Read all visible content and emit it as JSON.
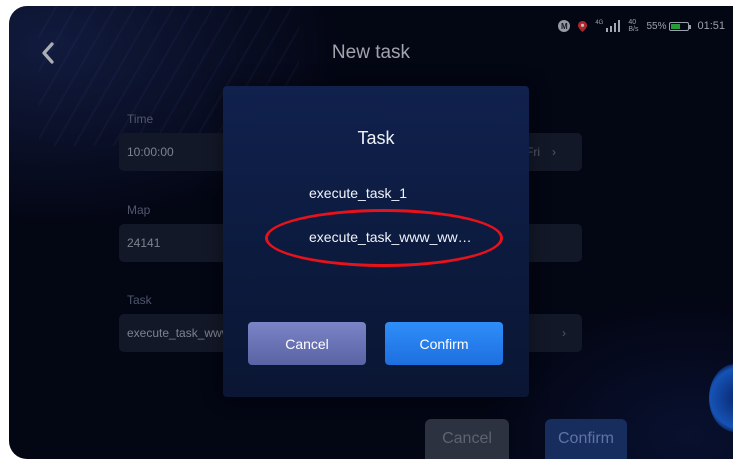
{
  "status_bar": {
    "m_badge": "M",
    "network_type": "4G",
    "rate_value": "40",
    "rate_unit": "B/s",
    "battery_percent": "55%",
    "battery_level": 0.55,
    "time": "01:51"
  },
  "header": {
    "title": "New task"
  },
  "form": {
    "time_label": "Time",
    "time_value": "10:00:00",
    "day_value": "Fri",
    "map_label": "Map",
    "map_value": "24141",
    "task_label": "Task",
    "task_value": "execute_task_www_ww"
  },
  "footer": {
    "cancel_label": "Cancel",
    "confirm_label": "Confirm"
  },
  "modal": {
    "title": "Task",
    "options": [
      "execute_task_1",
      "execute_task_www_ww…"
    ],
    "cancel_label": "Cancel",
    "confirm_label": "Confirm"
  },
  "colors": {
    "background": "#05081a",
    "modal_confirm": "#2f8ef8",
    "modal_cancel": "#6c75b8",
    "highlight": "#e8121b"
  }
}
